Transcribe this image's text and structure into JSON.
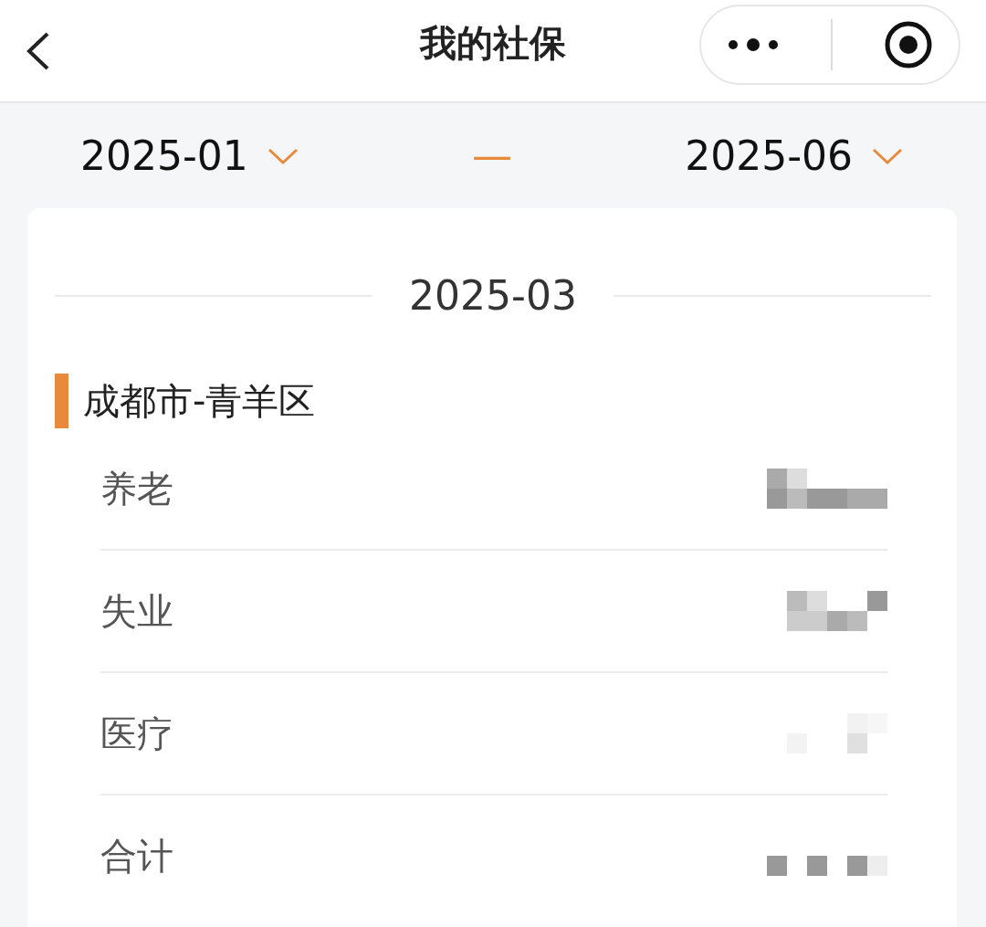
{
  "header": {
    "title": "我的社保"
  },
  "date_range": {
    "start": "2025-01",
    "separator": "—",
    "end": "2025-06"
  },
  "records": [
    {
      "month": "2025-03",
      "region": "成都市-青羊区",
      "items": [
        {
          "label": "养老"
        },
        {
          "label": "失业"
        },
        {
          "label": "医疗"
        },
        {
          "label": "合计"
        }
      ]
    }
  ]
}
